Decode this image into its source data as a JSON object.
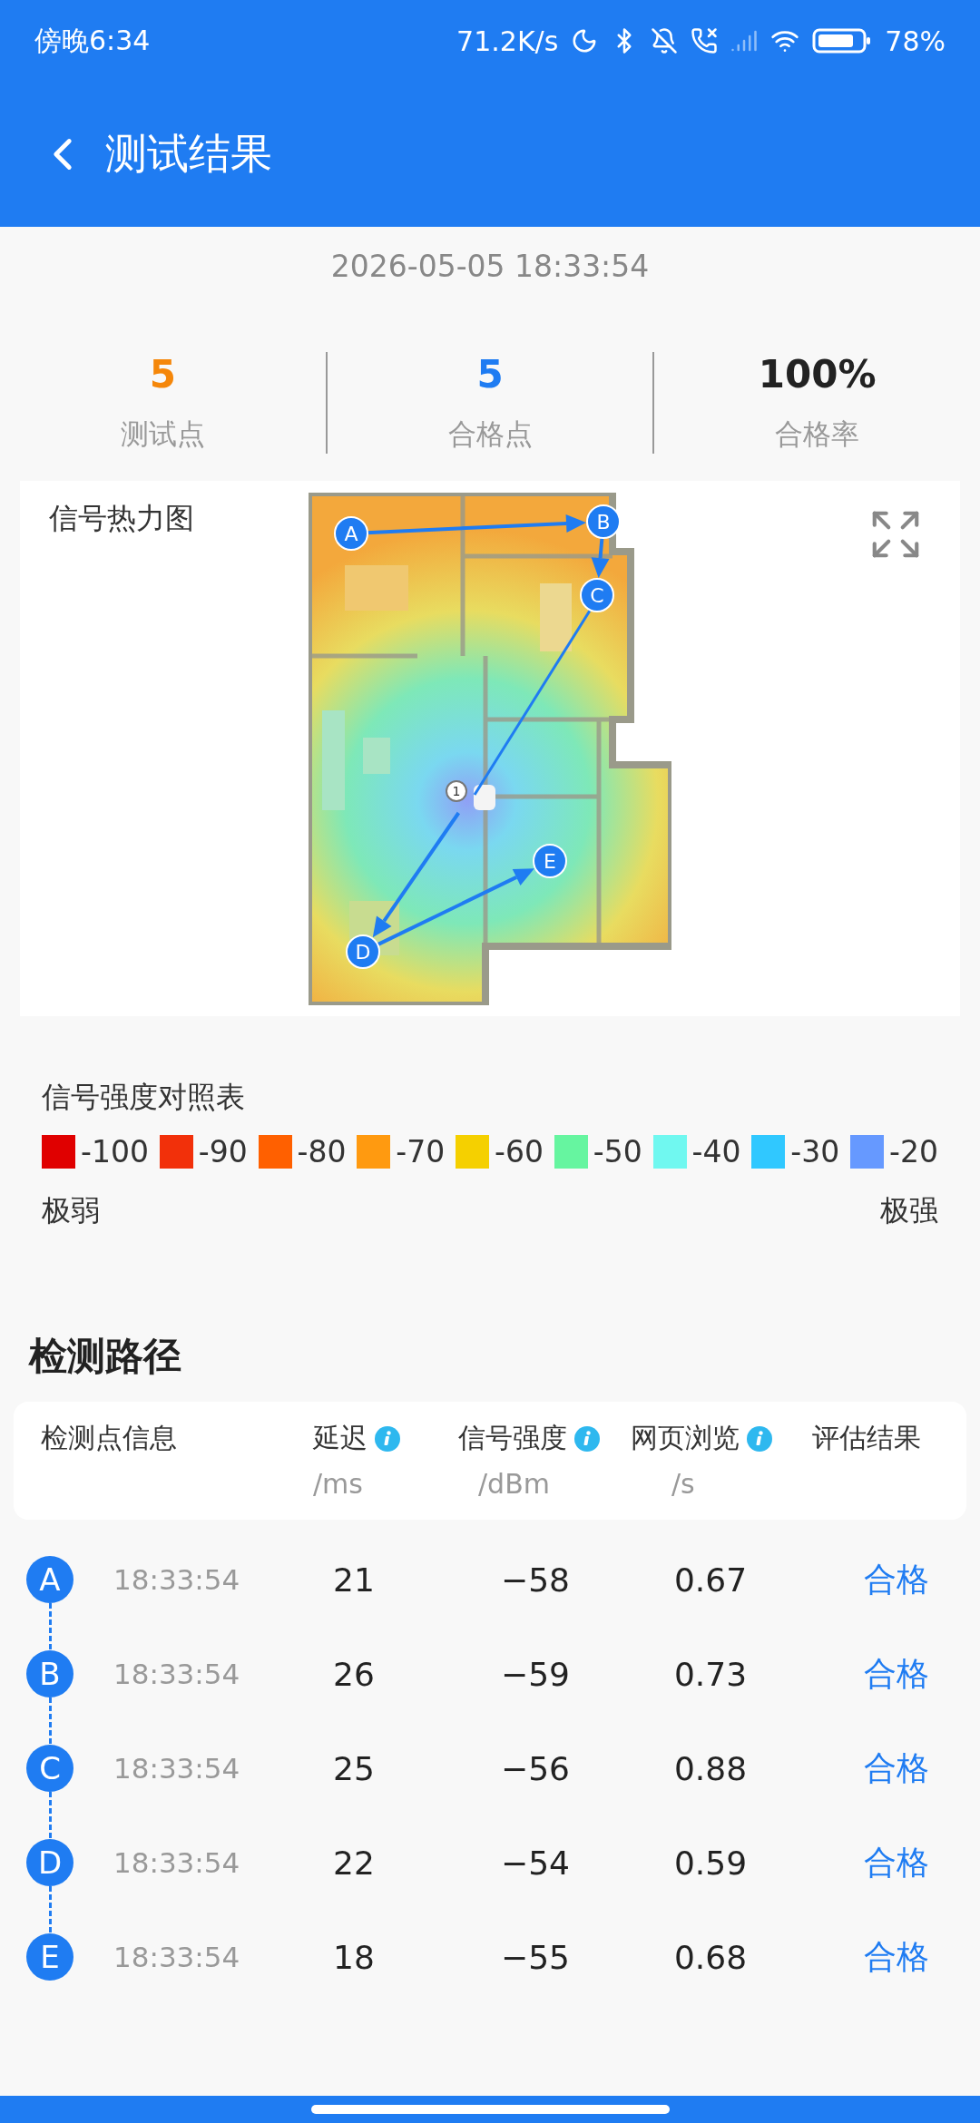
{
  "status_bar": {
    "time": "傍晚6:34",
    "net_speed": "71.2K/s",
    "battery": "78%"
  },
  "header": {
    "title": "测试结果"
  },
  "timestamp": "2026-05-05 18:33:54",
  "stats": [
    {
      "value": "5",
      "label": "测试点",
      "color": "#f5870a"
    },
    {
      "value": "5",
      "label": "合格点",
      "color": "#1f7cf2"
    },
    {
      "value": "100%",
      "label": "合格率",
      "color": "#222222"
    }
  ],
  "heatmap": {
    "title": "信号热力图",
    "device_label": "1",
    "points": [
      {
        "label": "A"
      },
      {
        "label": "B"
      },
      {
        "label": "C"
      },
      {
        "label": "D"
      },
      {
        "label": "E"
      }
    ]
  },
  "legend": {
    "title": "信号强度对照表",
    "levels": [
      {
        "value": "-100",
        "color": "#e00000"
      },
      {
        "value": "-90",
        "color": "#f2300a"
      },
      {
        "value": "-80",
        "color": "#ff6000"
      },
      {
        "value": "-70",
        "color": "#ff9a10"
      },
      {
        "value": "-60",
        "color": "#f5d000"
      },
      {
        "value": "-50",
        "color": "#66f5a0"
      },
      {
        "value": "-40",
        "color": "#70f8f0"
      },
      {
        "value": "-30",
        "color": "#30c8ff"
      },
      {
        "value": "-20",
        "color": "#6699ff"
      }
    ],
    "low_label": "极弱",
    "high_label": "极强"
  },
  "path": {
    "title": "检测路径",
    "columns": [
      {
        "label": "检测点信息",
        "info": false
      },
      {
        "label": "延迟",
        "unit": "/ms",
        "info": true
      },
      {
        "label": "信号强度",
        "unit": "/dBm",
        "info": true
      },
      {
        "label": "网页浏览",
        "unit": "/s",
        "info": true
      },
      {
        "label": "评估结果",
        "info": false
      }
    ],
    "rows": [
      {
        "point": "A",
        "time": "18:33:54",
        "latency": "21",
        "signal": "−58",
        "page": "0.67",
        "result": "合格"
      },
      {
        "point": "B",
        "time": "18:33:54",
        "latency": "26",
        "signal": "−59",
        "page": "0.73",
        "result": "合格"
      },
      {
        "point": "C",
        "time": "18:33:54",
        "latency": "25",
        "signal": "−56",
        "page": "0.88",
        "result": "合格"
      },
      {
        "point": "D",
        "time": "18:33:54",
        "latency": "22",
        "signal": "−54",
        "page": "0.59",
        "result": "合格"
      },
      {
        "point": "E",
        "time": "18:33:54",
        "latency": "18",
        "signal": "−55",
        "page": "0.68",
        "result": "合格"
      }
    ]
  }
}
